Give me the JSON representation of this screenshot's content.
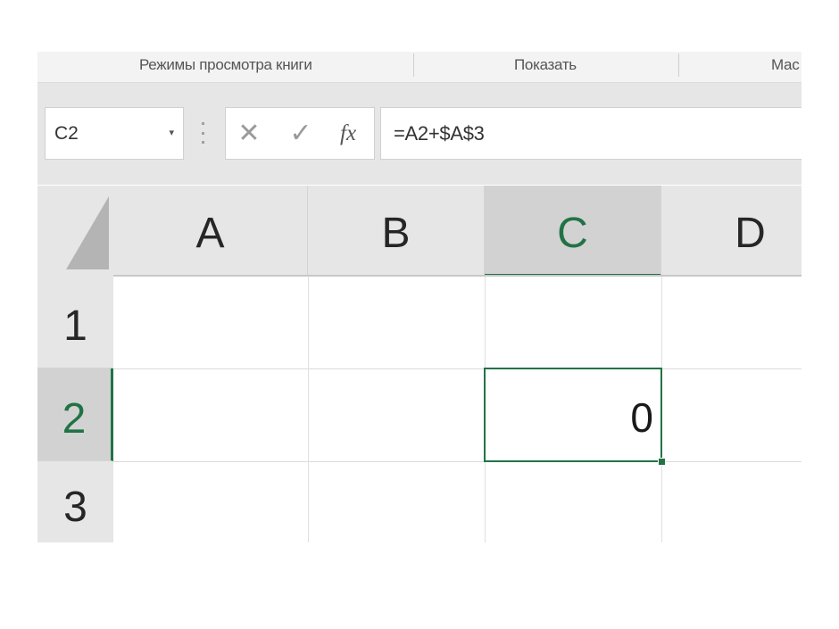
{
  "ribbon": {
    "groups": [
      {
        "label": "Режимы просмотра книги"
      },
      {
        "label": "Показать"
      },
      {
        "label": "Мас"
      }
    ]
  },
  "formula_bar": {
    "name_box_value": "C2",
    "name_box_arrow": "▾",
    "cancel_symbol": "✕",
    "enter_symbol": "✓",
    "fx_symbol": "fx",
    "formula": "=A2+$A$3"
  },
  "sheet": {
    "active_cell": "C2",
    "columns": [
      "A",
      "B",
      "C",
      "D"
    ],
    "rows": [
      "1",
      "2",
      "3"
    ],
    "cells": {
      "C2": "0"
    }
  },
  "colors": {
    "accent": "#217346",
    "header_bg": "#e6e6e6",
    "header_active_bg": "#d2d2d2"
  }
}
